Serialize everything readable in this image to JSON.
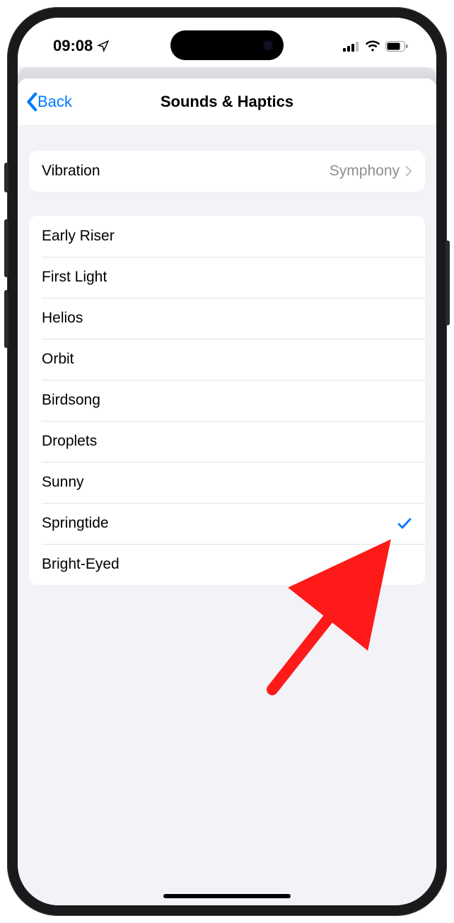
{
  "status": {
    "time": "09:08"
  },
  "nav": {
    "back": "Back",
    "title": "Sounds & Haptics"
  },
  "vibration": {
    "label": "Vibration",
    "value": "Symphony"
  },
  "sounds": [
    {
      "label": "Early Riser",
      "selected": false
    },
    {
      "label": "First Light",
      "selected": false
    },
    {
      "label": "Helios",
      "selected": false
    },
    {
      "label": "Orbit",
      "selected": false
    },
    {
      "label": "Birdsong",
      "selected": false
    },
    {
      "label": "Droplets",
      "selected": false
    },
    {
      "label": "Sunny",
      "selected": false
    },
    {
      "label": "Springtide",
      "selected": true
    },
    {
      "label": "Bright-Eyed",
      "selected": false
    }
  ],
  "colors": {
    "tint": "#007aff",
    "annotation": "#ff1a1a"
  }
}
